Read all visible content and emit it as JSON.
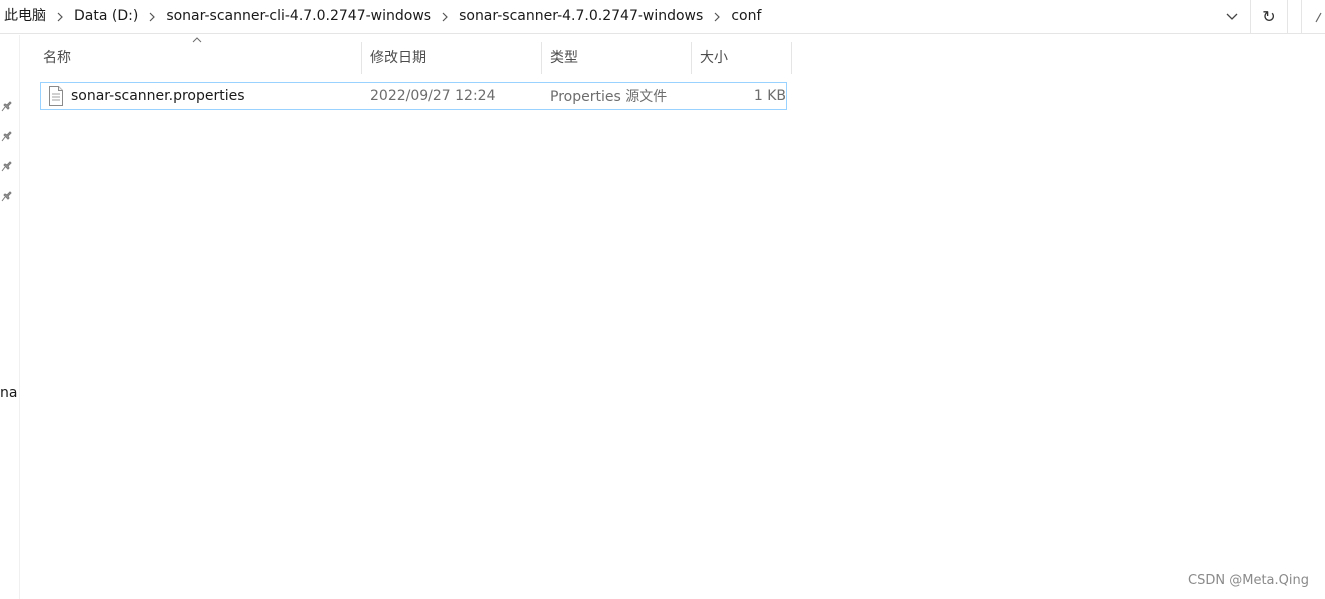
{
  "breadcrumb": {
    "items": [
      "此电脑",
      "Data (D:)",
      "sonar-scanner-cli-4.7.0.2747-windows",
      "sonar-scanner-4.7.0.2747-windows",
      "conf"
    ]
  },
  "toolbar": {
    "dropdown_icon": "chevron-down-icon",
    "refresh_icon": "refresh-icon",
    "refresh_glyph": "↻"
  },
  "navpane": {
    "pinned_count": 4,
    "partial_label": "na"
  },
  "columns": {
    "name": "名称",
    "date": "修改日期",
    "type": "类型",
    "size": "大小",
    "sort_column": "name"
  },
  "files": [
    {
      "name": "sonar-scanner.properties",
      "modified": "2022/09/27 12:24",
      "type": "Properties 源文件",
      "size": "1 KB",
      "icon": "text-file-icon",
      "selected": true
    }
  ],
  "colors": {
    "selection_border": "#99d1ff",
    "separator": "#e5e5e5",
    "muted_text": "#6d6d6d"
  },
  "watermark": "CSDN @Meta.Qing"
}
